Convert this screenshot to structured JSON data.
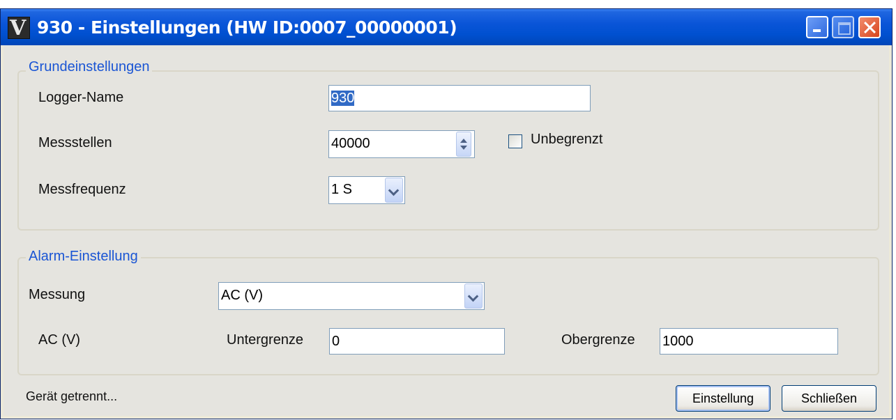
{
  "window": {
    "title": "930 - Einstellungen (HW ID:0007_00000001)",
    "app_icon_glyph": "V",
    "icon": "app-logo-icon",
    "controls": [
      "minimize-icon",
      "maximize-icon",
      "close-icon"
    ]
  },
  "basic": {
    "legend": "Grundeinstellungen",
    "logger_name_label": "Logger-Name",
    "logger_name_value": "930",
    "points_label": "Messstellen",
    "points_value": "40000",
    "unlimited_label": "Unbegrenzt",
    "unlimited_checked": false,
    "frequency_label": "Messfrequenz",
    "frequency_value": "1 S"
  },
  "alarm": {
    "legend": "Alarm-Einstellung",
    "measurement_label": "Messung",
    "measurement_value": "AC (V)",
    "channel_label": "AC (V)",
    "lower_label": "Untergrenze",
    "lower_value": "0",
    "upper_label": "Obergrenze",
    "upper_value": "1000"
  },
  "status": "Gerät getrennt...",
  "buttons": {
    "apply": "Einstellung",
    "close": "Schließen"
  },
  "colors": {
    "titlebar": "#0050d0",
    "legend_text": "#1a55d4",
    "selection": "#316ac5"
  }
}
